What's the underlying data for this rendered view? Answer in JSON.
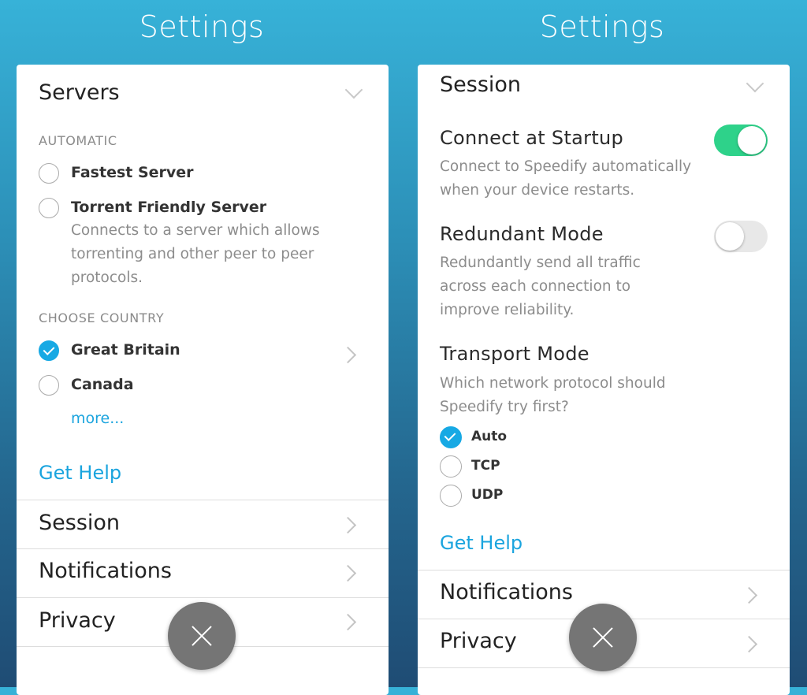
{
  "left": {
    "title": "Settings",
    "section_header": "Servers",
    "automatic_heading": "AUTOMATIC",
    "options": [
      {
        "label": "Fastest Server",
        "checked": false
      },
      {
        "label": "Torrent Friendly Server",
        "checked": false,
        "description_lines": [
          "Connects to a server which allows",
          "torrenting and other peer to peer",
          "protocols."
        ]
      }
    ],
    "country_heading": "CHOOSE COUNTRY",
    "countries": [
      {
        "label": "Great Britain",
        "checked": true
      },
      {
        "label": "Canada",
        "checked": false
      }
    ],
    "more_link": "more...",
    "get_help": "Get Help",
    "rows": [
      "Session",
      "Notifications",
      "Privacy"
    ]
  },
  "right": {
    "title": "Settings",
    "section_header": "Session",
    "connect_startup": {
      "title": "Connect at Startup",
      "desc_lines": [
        "Connect to Speedify automatically",
        "when your device restarts."
      ],
      "enabled": true
    },
    "redundant_mode": {
      "title": "Redundant Mode",
      "desc_lines": [
        "Redundantly send all traffic",
        "across each connection to",
        "improve reliability."
      ],
      "enabled": false
    },
    "transport_mode": {
      "title": "Transport Mode",
      "desc_lines": [
        "Which network protocol should",
        "Speedify try first?"
      ],
      "options": [
        {
          "label": "Auto",
          "checked": true
        },
        {
          "label": "TCP",
          "checked": false
        },
        {
          "label": "UDP",
          "checked": false
        }
      ]
    },
    "get_help": "Get Help",
    "rows": [
      "Notifications",
      "Privacy"
    ]
  },
  "colors": {
    "accent": "#1aa4de",
    "toggle_on": "#2ed28a",
    "close_button": "#757575"
  }
}
